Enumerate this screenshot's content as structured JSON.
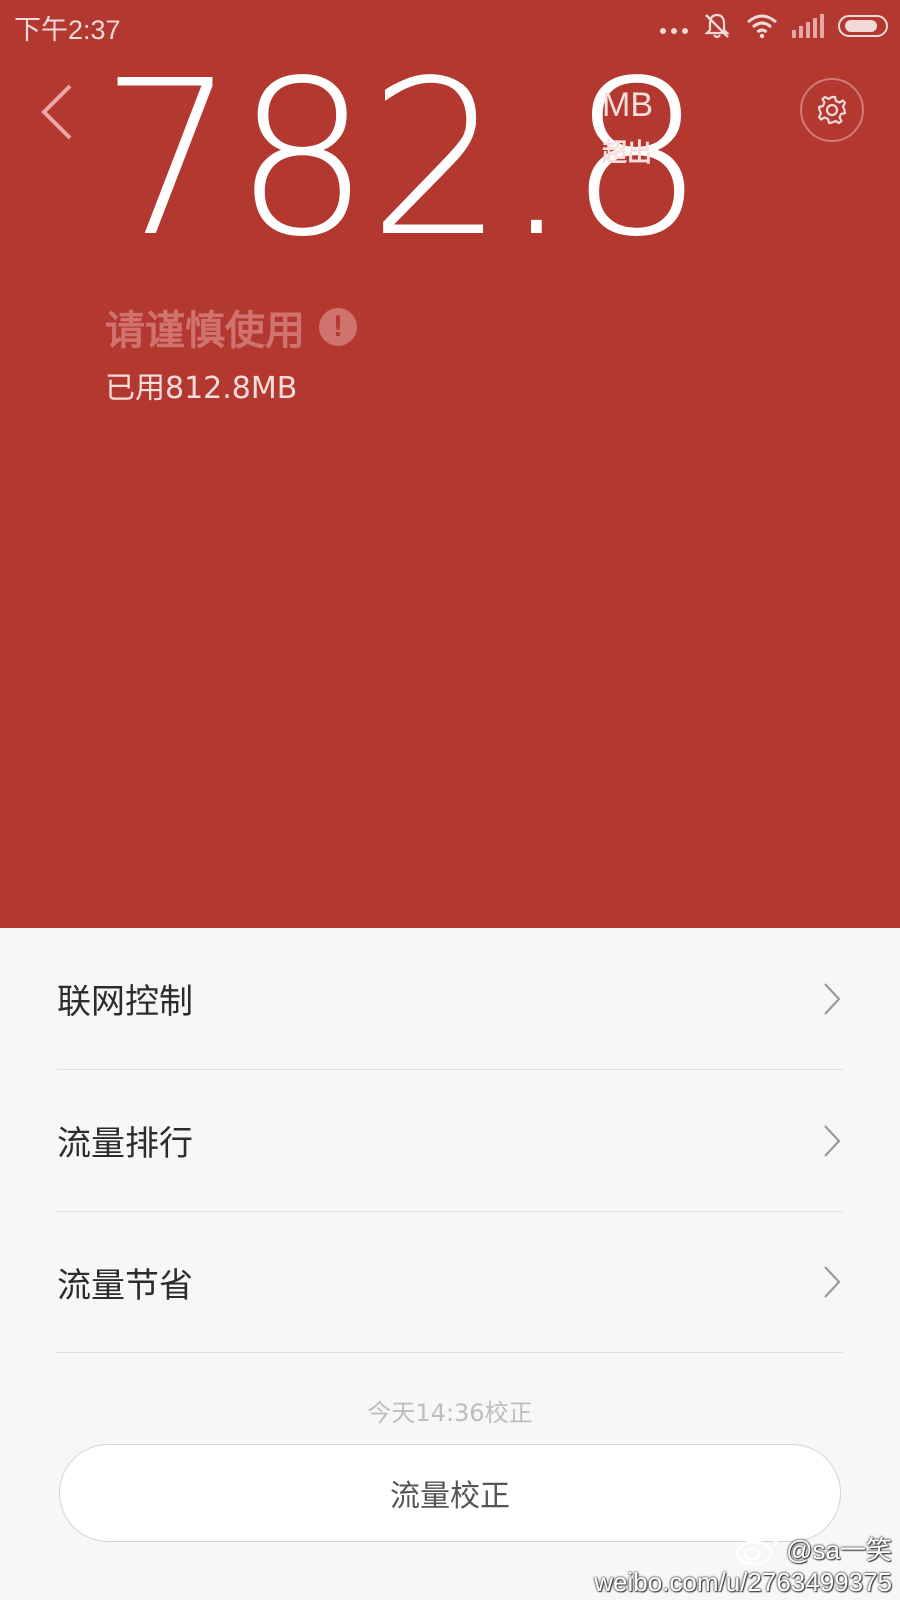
{
  "status_bar": {
    "time": "下午2:37",
    "icons": [
      "more-dots-icon",
      "notifications-muted-icon",
      "wifi-icon",
      "cellular-signal-icon",
      "battery-icon"
    ]
  },
  "header": {
    "back_icon": "chevron-left-icon",
    "amount": "782.8",
    "unit": "MB",
    "status": "超出",
    "settings_icon": "gear-icon",
    "warning": "请谨慎使用",
    "warning_icon": "exclamation-circle-icon",
    "used": "已用812.8MB"
  },
  "menu": {
    "items": [
      {
        "label": "联网控制",
        "icon": "chevron-right-icon"
      },
      {
        "label": "流量排行",
        "icon": "chevron-right-icon"
      },
      {
        "label": "流量节省",
        "icon": "chevron-right-icon"
      }
    ]
  },
  "calibration": {
    "last_time": "今天14:36校正",
    "button_label": "流量校正"
  },
  "watermark": {
    "user": "@sa一笑",
    "url": "weibo.com/u/2763499375"
  },
  "colors": {
    "header_bg": "#b33830",
    "body_bg": "#f7f7f7",
    "warning_text": "#d0736e"
  }
}
